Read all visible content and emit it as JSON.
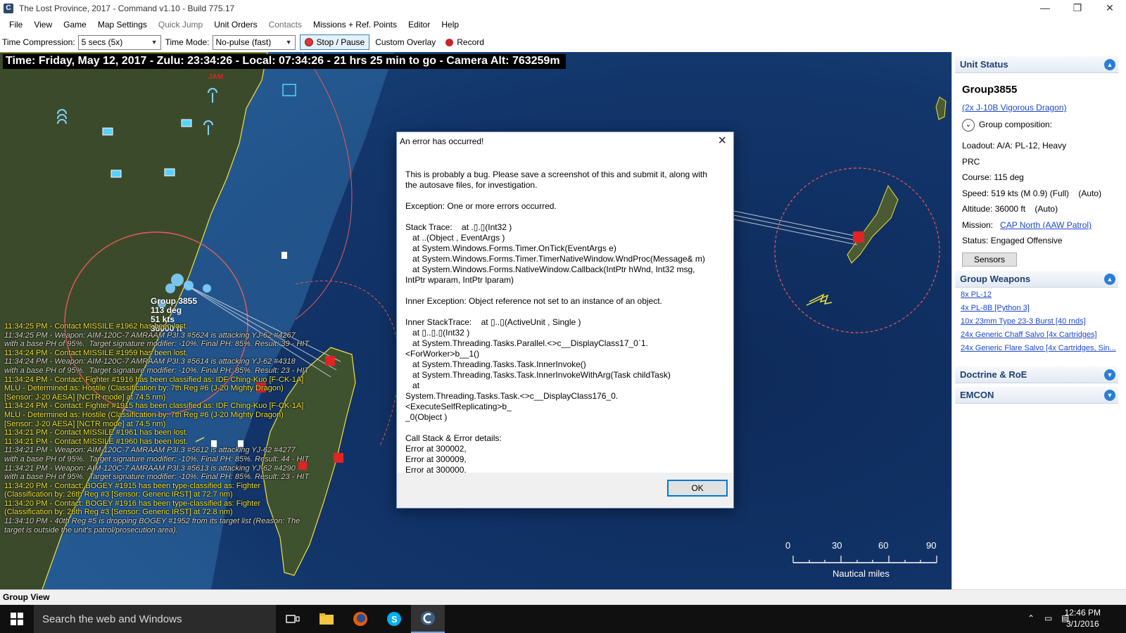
{
  "window": {
    "title": "The Lost Province, 2017 - Command v1.10 - Build 775.17",
    "app_icon_glyph": "C",
    "controls": {
      "minimize": "—",
      "maximize": "❐",
      "close": "✕"
    }
  },
  "menu": [
    "File",
    "View",
    "Game",
    "Map Settings",
    "Quick Jump",
    "Unit Orders",
    "Contacts",
    "Missions + Ref. Points",
    "Editor",
    "Help"
  ],
  "menu_disabled": [
    "Quick Jump",
    "Contacts"
  ],
  "toolbar": {
    "time_compression_label": "Time Compression:",
    "time_compression_value": "5 secs (5x)",
    "time_mode_label": "Time Mode:",
    "time_mode_value": "No-pulse (fast)",
    "stop_pause_label": "Stop / Pause",
    "custom_overlay_label": "Custom Overlay",
    "record_label": "Record"
  },
  "map": {
    "time_banner": "Time: Friday, May 12, 2017 - Zulu: 23:34:26 - Local: 07:34:26 - 21 hrs 25 min to go -  Camera Alt: 763259m",
    "jam_label": "JAM",
    "unit_label": [
      "Group 3855",
      "113 deg",
      "51 kts",
      "36000 ft"
    ],
    "scale": {
      "ticks": [
        "0",
        "30",
        "60",
        "90"
      ],
      "caption": "Nautical miles"
    },
    "colors": {
      "sea": "#10305c",
      "land": "#3b4a2a",
      "range_ring": "#e85a5a",
      "coast": "#f0e23a"
    }
  },
  "message_log": [
    {
      "text": "11:34:25 PM - Contact MISSILE #1962 has been lost.",
      "style": "yellow"
    },
    {
      "text": "11:34:25 PM - Weapon: AIM-120C-7 AMRAAM P3I.3 #5624 is attacking YJ-62 #4267\nwith a base PH of 95%.  Target signature modifier: -10%. Final PH: 85%. Result: 39 - HIT",
      "style": "gray"
    },
    {
      "text": "11:34:24 PM - Contact MISSILE #1959 has been lost.",
      "style": "yellow"
    },
    {
      "text": "11:34:24 PM - Weapon: AIM-120C-7 AMRAAM P3I.3 #5614 is attacking YJ-62 #4318\nwith a base PH of 95%.  Target signature modifier: -10%. Final PH: 85%. Result: 23 - HIT",
      "style": "gray"
    },
    {
      "text": "11:34:24 PM - Contact: Fighter #1916 has been classified as: IDF Ching-Kuo [F-CK-1A]\nMLU - Determined as: Hostile (Classification by: 7th Reg #6 (J-20 Mighty Dragon)\n[Sensor: J-20 AESA] [NCTR mode] at 74.5 nm)",
      "style": "yellow"
    },
    {
      "text": "11:34:24 PM - Contact: Fighter #1915 has been classified as: IDF Ching-Kuo [F-CK-1A]\nMLU - Determined as: Hostile (Classification by: 7th Reg #6 (J-20 Mighty Dragon)\n[Sensor: J-20 AESA] [NCTR mode] at 74.5 nm)",
      "style": "yellow"
    },
    {
      "text": "11:34:21 PM - Contact MISSILE #1961 has been lost.",
      "style": "yellow"
    },
    {
      "text": "11:34:21 PM - Contact MISSILE #1960 has been lost.",
      "style": "yellow"
    },
    {
      "text": "11:34:21 PM - Weapon: AIM-120C-7 AMRAAM P3I.3 #5612 is attacking YJ-62 #4277\nwith a base PH of 95%.  Target signature modifier: -10%. Final PH: 85%. Result: 44 - HIT",
      "style": "gray"
    },
    {
      "text": "11:34:21 PM - Weapon: AIM-120C-7 AMRAAM P3I.3 #5613 is attacking YJ-62 #4290\nwith a base PH of 95%.  Target signature modifier: -10%. Final PH: 85%. Result: 23 - HIT",
      "style": "gray"
    },
    {
      "text": "11:34:20 PM - Contact: BOGEY #1915 has been type-classified as: Fighter\n(Classification by: 26th Reg #3 [Sensor: Generic IRST] at 72.7 nm)",
      "style": "yellow"
    },
    {
      "text": "11:34:20 PM - Contact: BOGEY #1916 has been type-classified as: Fighter\n(Classification by: 26th Reg #3 [Sensor: Generic IRST] at 72.8 nm)",
      "style": "yellow"
    },
    {
      "text": "11:34:10 PM - 40th Reg #5 is dropping BOGEY #1952 from its target list (Reason: The\ntarget is outside the unit's patrol/prosecution area).",
      "style": "gray"
    }
  ],
  "unit_status": {
    "header": "Unit Status",
    "group_name": "Group3855",
    "composition_link": "(2x J-10B Vigorous Dragon)",
    "group_composition_label": "Group composition:",
    "loadout": "Loadout: A/A: PL-12, Heavy",
    "side": "PRC",
    "course": "Course: 115 deg",
    "speed": "Speed: 519 kts (M 0.9) (Full)    (Auto)",
    "altitude": "Altitude: 36000 ft    (Auto)",
    "mission_label": "Mission:",
    "mission_link": "CAP North (AAW Patrol)",
    "status": "Status: Engaged Offensive",
    "sensors_button": "Sensors"
  },
  "group_weapons": {
    "header": "Group Weapons",
    "items": [
      "8x PL-12",
      "4x PL-8B [Python 3]",
      "10x 23mm Type 23-3 Burst [40 rnds]",
      "24x Generic Chaff Salvo [4x Cartridges]",
      "24x Generic Flare Salvo [4x Cartridges, Sin..."
    ]
  },
  "doctrine_header": "Doctrine & RoE",
  "emcon_header": "EMCON",
  "statusbar": "Group View",
  "taskbar": {
    "search_placeholder": "Search the web and Windows",
    "time": "12:46 PM",
    "date": "3/1/2016"
  },
  "dialog": {
    "title": "An error has occurred!",
    "body": "This is probably a bug. Please save a screenshot of this and submit it, along with\nthe autosave files, for investigation.\n\nException: One or more errors occurred.\n\nStack Trace:    at .▯.▯(Int32 )\n   at ..(Object , EventArgs )\n   at System.Windows.Forms.Timer.OnTick(EventArgs e)\n   at System.Windows.Forms.Timer.TimerNativeWindow.WndProc(Message& m)\n   at System.Windows.Forms.NativeWindow.Callback(IntPtr hWnd, Int32 msg,\nIntPtr wparam, IntPtr lparam)\n\nInner Exception: Object reference not set to an instance of an object.\n\nInner StackTrace:    at ▯..▯(ActiveUnit , Single )\n   at ▯..▯.▯(Int32 )\n   at System.Threading.Tasks.Parallel.<>c__DisplayClass17_0`1.<ForWorker>b__1()\n   at System.Threading.Tasks.Task.InnerInvoke()\n   at System.Threading.Tasks.Task.InnerInvokeWithArg(Task childTask)\n   at\nSystem.Threading.Tasks.Task.<>c__DisplayClass176_0.<ExecuteSelfReplicating>b_\n_0(Object )\n\nCall Stack & Error details:\nError at 300002,\nError at 300009,\nError at 300000,",
    "ok_label": "OK"
  }
}
